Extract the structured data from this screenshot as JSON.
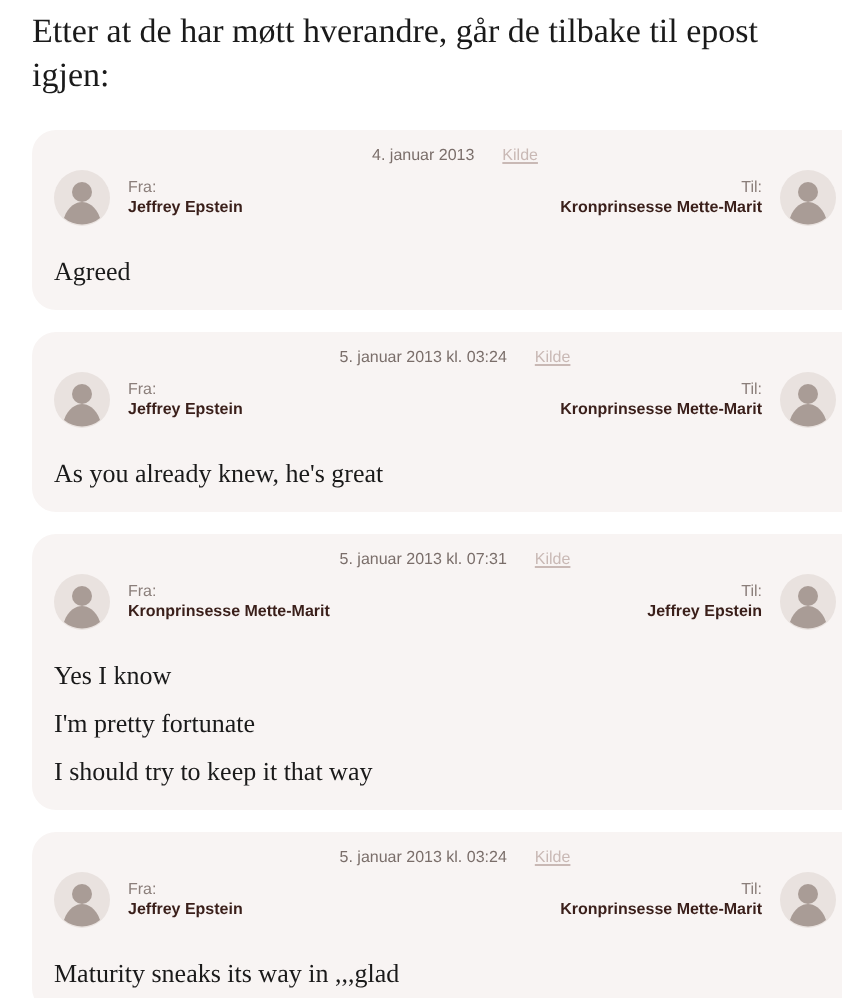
{
  "intro": "Etter at de har møtt hverandre, går de tilbake til epost igjen:",
  "emails": [
    {
      "date": "4. januar 2013",
      "source": "Kilde",
      "from_label": "Fra:",
      "from": "Jeffrey Epstein",
      "to_label": "Til:",
      "to": "Kronprinsesse Mette-Marit",
      "lines": [
        "Agreed"
      ]
    },
    {
      "date": "5. januar 2013 kl. 03:24",
      "source": "Kilde",
      "from_label": "Fra:",
      "from": "Jeffrey Epstein",
      "to_label": "Til:",
      "to": "Kronprinsesse Mette-Marit",
      "lines": [
        "As you already knew, he's great"
      ]
    },
    {
      "date": "5. januar 2013 kl. 07:31",
      "source": "Kilde",
      "from_label": "Fra:",
      "from": "Kronprinsesse Mette-Marit",
      "to_label": "Til:",
      "to": "Jeffrey Epstein",
      "lines": [
        "Yes I know",
        "I'm pretty fortunate",
        "I should try to keep it that way"
      ]
    },
    {
      "date": "5. januar 2013 kl. 03:24",
      "source": "Kilde",
      "from_label": "Fra:",
      "from": "Jeffrey Epstein",
      "to_label": "Til:",
      "to": "Kronprinsesse Mette-Marit",
      "lines": [
        "Maturity sneaks its way in ,,,glad"
      ]
    }
  ]
}
